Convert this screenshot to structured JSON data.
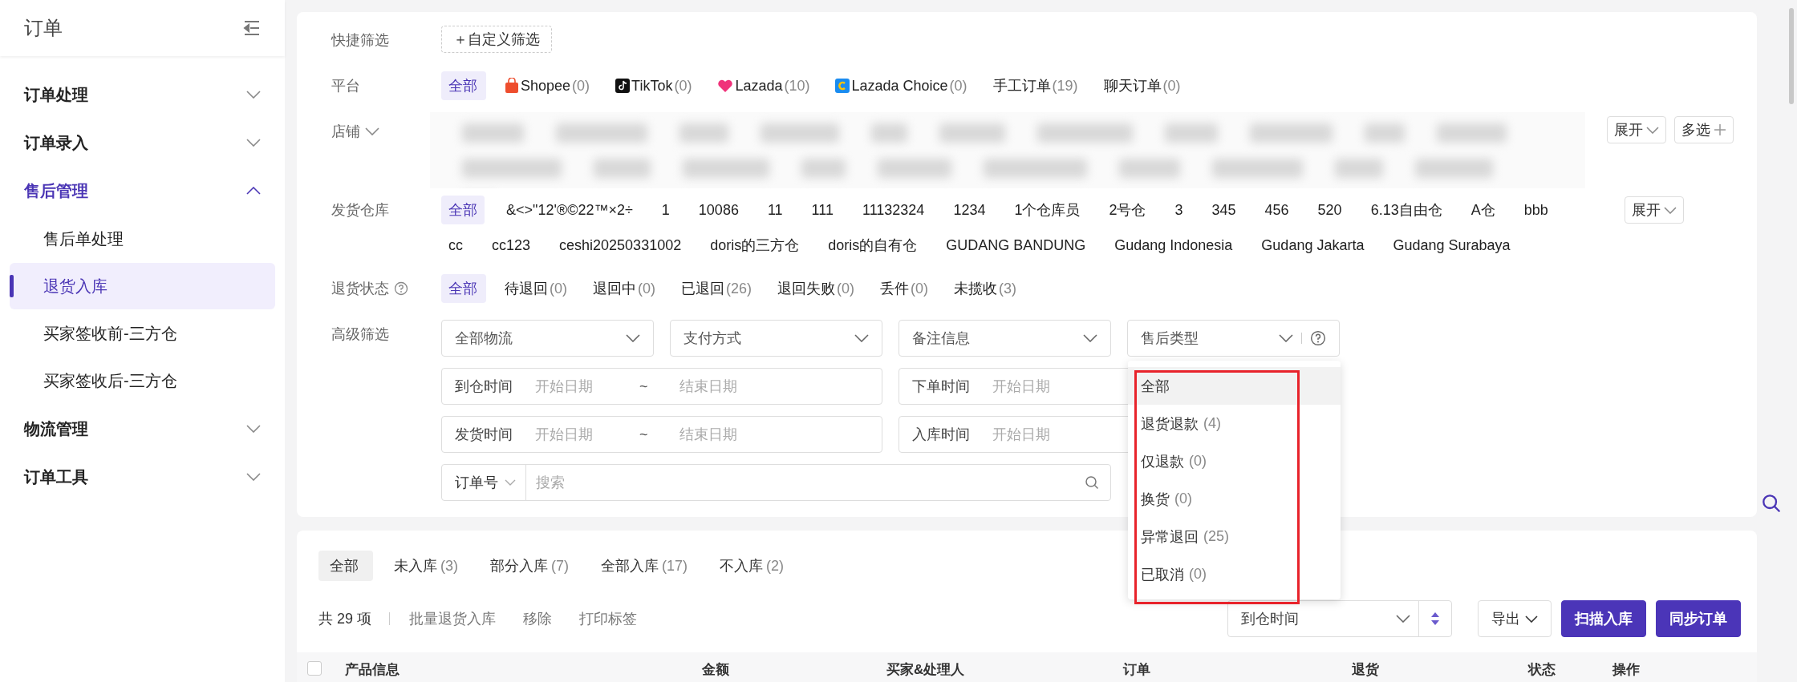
{
  "sidebar": {
    "title": "订单",
    "items": [
      {
        "label": "订单处理",
        "expanded": false
      },
      {
        "label": "订单录入",
        "expanded": false
      },
      {
        "label": "售后管理",
        "expanded": true,
        "children": [
          {
            "label": "售后单处理",
            "selected": false
          },
          {
            "label": "退货入库",
            "selected": true
          },
          {
            "label": "买家签收前-三方仓",
            "selected": false
          },
          {
            "label": "买家签收后-三方仓",
            "selected": false
          }
        ]
      },
      {
        "label": "物流管理",
        "expanded": false
      },
      {
        "label": "订单工具",
        "expanded": false
      }
    ]
  },
  "quick_filter": {
    "label": "快捷筛选",
    "button": "＋自定义筛选"
  },
  "platform": {
    "label": "平台",
    "options": [
      {
        "label": "全部",
        "kind": "text",
        "selected": true
      },
      {
        "label": "Shopee",
        "count": "(0)",
        "kind": "bag",
        "selected": false
      },
      {
        "label": "TikTok",
        "count": "(0)",
        "kind": "note",
        "selected": false
      },
      {
        "label": "Lazada",
        "count": "(10)",
        "kind": "heart",
        "selected": false
      },
      {
        "label": "Lazada Choice",
        "count": "(0)",
        "kind": "tile",
        "selected": false
      },
      {
        "label": "手工订单",
        "count": "(19)",
        "kind": "text",
        "selected": false
      },
      {
        "label": "聊天订单",
        "count": "(0)",
        "kind": "text",
        "selected": false
      }
    ]
  },
  "store": {
    "label": "店铺",
    "expand_button": "展开",
    "multi_button": "多选"
  },
  "warehouse": {
    "label": "发货仓库",
    "expand_button": "展开",
    "options": [
      {
        "label": "全部",
        "selected": true
      },
      {
        "label": "&<>\"12'®©22™×2÷",
        "selected": false
      },
      {
        "label": "1",
        "selected": false
      },
      {
        "label": "10086",
        "selected": false
      },
      {
        "label": "11",
        "selected": false
      },
      {
        "label": "111",
        "selected": false
      },
      {
        "label": "11132324",
        "selected": false
      },
      {
        "label": "1234",
        "selected": false
      },
      {
        "label": "1个仓库员",
        "selected": false
      },
      {
        "label": "2号仓",
        "selected": false
      },
      {
        "label": "3",
        "selected": false
      },
      {
        "label": "345",
        "selected": false
      },
      {
        "label": "456",
        "selected": false
      },
      {
        "label": "520",
        "selected": false
      },
      {
        "label": "6.13自由仓",
        "selected": false
      },
      {
        "label": "A仓",
        "selected": false
      },
      {
        "label": "bbb",
        "selected": false
      },
      {
        "label": "cc",
        "selected": false
      },
      {
        "label": "cc123",
        "selected": false
      },
      {
        "label": "ceshi20250331002",
        "selected": false
      },
      {
        "label": "doris的三方仓",
        "selected": false
      },
      {
        "label": "doris的自有仓",
        "selected": false
      },
      {
        "label": "GUDANG BANDUNG",
        "selected": false
      },
      {
        "label": "Gudang Indonesia",
        "selected": false
      },
      {
        "label": "Gudang Jakarta",
        "selected": false
      },
      {
        "label": "Gudang Surabaya",
        "selected": false
      }
    ]
  },
  "return_status": {
    "label": "退货状态",
    "options": [
      {
        "label": "全部",
        "selected": true
      },
      {
        "label": "待退回",
        "count": "(0)",
        "selected": false
      },
      {
        "label": "退回中",
        "count": "(0)",
        "selected": false
      },
      {
        "label": "已退回",
        "count": "(26)",
        "selected": false
      },
      {
        "label": "退回失败",
        "count": "(0)",
        "selected": false
      },
      {
        "label": "丢件",
        "count": "(0)",
        "selected": false
      },
      {
        "label": "未揽收",
        "count": "(3)",
        "selected": false
      }
    ]
  },
  "advanced": {
    "label": "高级筛选",
    "selects": [
      {
        "placeholder": "全部物流",
        "help": false
      },
      {
        "placeholder": "支付方式",
        "help": false
      },
      {
        "placeholder": "备注信息",
        "help": false
      },
      {
        "placeholder": "售后类型",
        "help": true
      }
    ],
    "date_ranges": [
      {
        "label": "到仓时间",
        "start_placeholder": "开始日期",
        "separator": "~",
        "end_placeholder": "结束日期"
      },
      {
        "label": "下单时间",
        "start_placeholder": "开始日期"
      },
      {
        "label": "发货时间",
        "start_placeholder": "开始日期",
        "separator": "~",
        "end_placeholder": "结束日期"
      },
      {
        "label": "入库时间",
        "start_placeholder": "开始日期"
      }
    ],
    "search": {
      "field": "订单号",
      "placeholder": "搜索"
    },
    "dropdown": {
      "open": true,
      "items": [
        {
          "label": "全部",
          "hovered": true
        },
        {
          "label": "退货退款",
          "count": "(4)",
          "hovered": false
        },
        {
          "label": "仅退款",
          "count": "(0)",
          "hovered": false
        },
        {
          "label": "换货",
          "count": "(0)",
          "hovered": false
        },
        {
          "label": "异常退回",
          "count": "(25)",
          "hovered": false
        },
        {
          "label": "已取消",
          "count": "(0)",
          "hovered": false
        }
      ]
    }
  },
  "list": {
    "tabs": [
      {
        "label": "全部",
        "selected": true
      },
      {
        "label": "未入库",
        "count": "(3)",
        "selected": false
      },
      {
        "label": "部分入库",
        "count": "(7)",
        "selected": false
      },
      {
        "label": "全部入库",
        "count": "(17)",
        "selected": false
      },
      {
        "label": "不入库",
        "count": "(2)",
        "selected": false
      }
    ],
    "total": "共 29 项",
    "actions": [
      "批量退货入库",
      "移除",
      "打印标签"
    ],
    "sort_select": "到仓时间",
    "export_button": "导出",
    "buttons": [
      "扫描入库",
      "同步订单"
    ],
    "select_all": {
      "checked": false
    },
    "columns": [
      "产品信息",
      "金额",
      "买家&处理人",
      "订单",
      "退货",
      "状态",
      "操作"
    ]
  }
}
